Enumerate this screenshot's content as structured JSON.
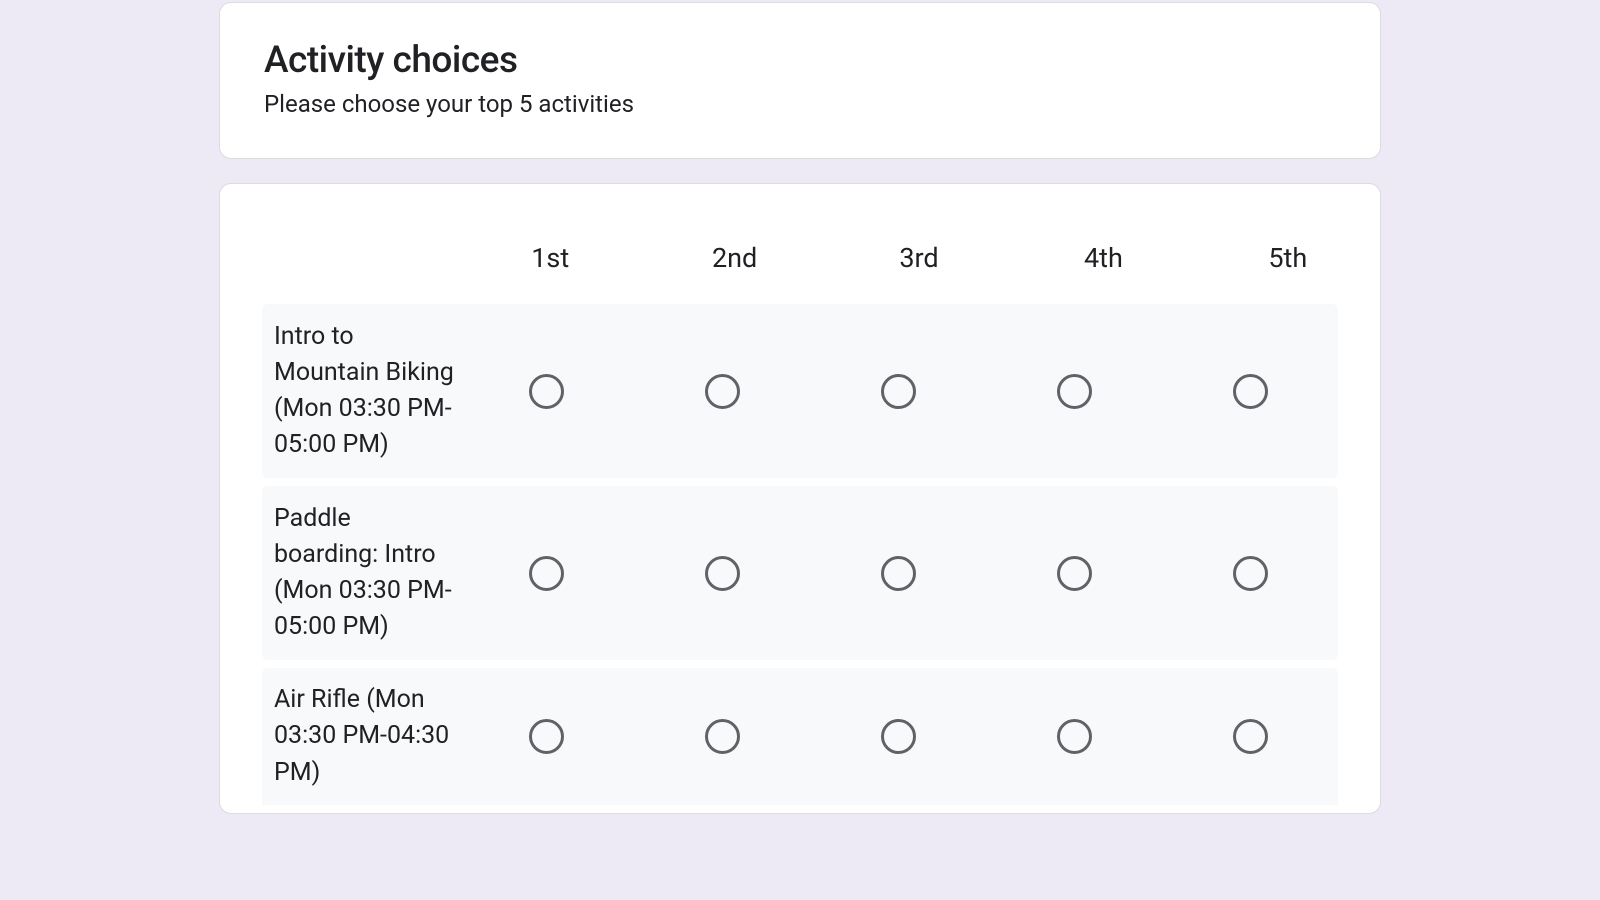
{
  "header": {
    "title": "Activity choices",
    "description": "Please choose your top 5 activities"
  },
  "grid": {
    "columns": [
      "1st",
      "2nd",
      "3rd",
      "4th",
      "5th"
    ],
    "rows": [
      {
        "label": "Intro to Mountain Biking (Mon 03:30 PM-05:00 PM)"
      },
      {
        "label": "Paddle boarding: Intro (Mon 03:30 PM-05:00 PM)"
      },
      {
        "label": "Air Rifle (Mon 03:30 PM-04:30 PM)"
      }
    ]
  }
}
